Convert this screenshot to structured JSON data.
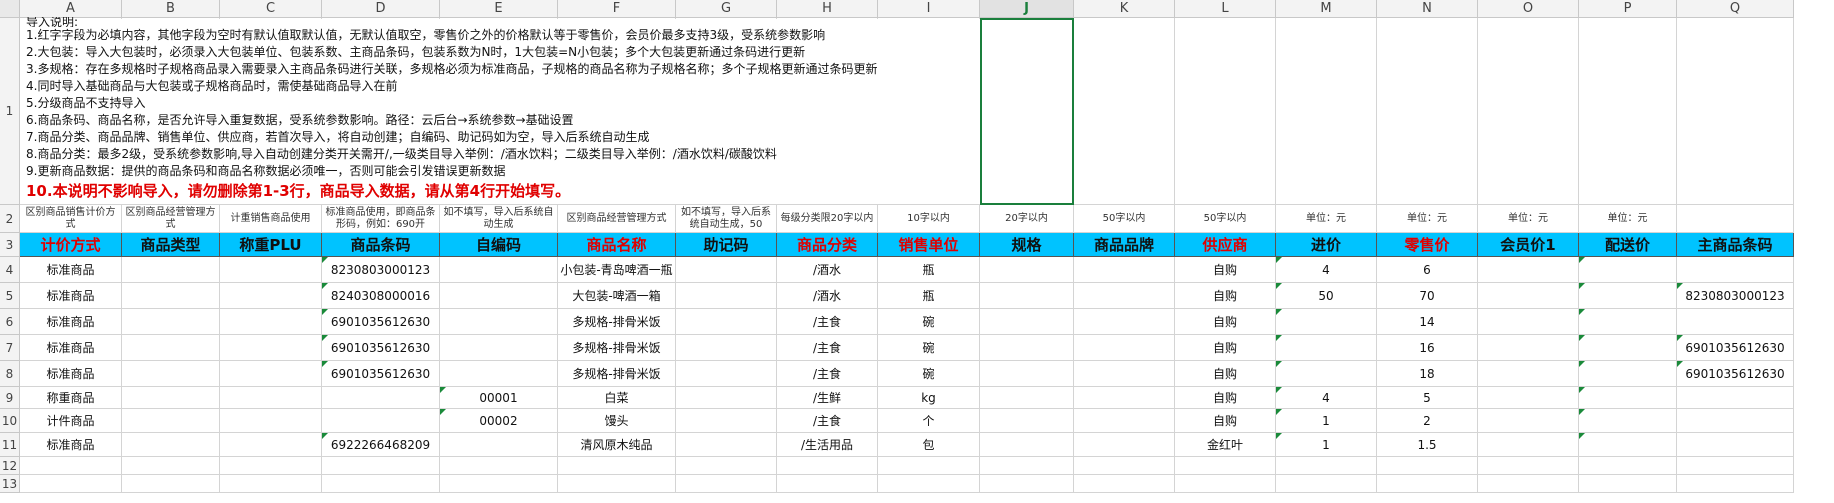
{
  "columns": [
    "A",
    "B",
    "C",
    "D",
    "E",
    "F",
    "G",
    "H",
    "I",
    "J",
    "K",
    "L",
    "M",
    "N",
    "O",
    "P",
    "Q"
  ],
  "selected_column": "J",
  "rows": [
    "1",
    "2",
    "3",
    "4",
    "5",
    "6",
    "7",
    "8",
    "9",
    "10",
    "11",
    "12",
    "13"
  ],
  "instructions": {
    "title": "导入说明:",
    "lines": [
      "1.红字字段为必填内容，其他字段为空时有默认值取默认值，无默认值取空，零售价之外的价格默认等于零售价，会员价最多支持3级，受系统参数影响",
      "2.大包装：导入大包装时，必须录入大包装单位、包装系数、主商品条码，包装系数为N时，1大包装=N小包装；多个大包装更新通过条码进行更新",
      "3.多规格：存在多规格时子规格商品录入需要录入主商品条码进行关联，多规格必须为标准商品，子规格的商品名称为子规格名称；多个子规格更新通过条码更新",
      "4.同时导入基础商品与大包装或子规格商品时，需使基础商品导入在前",
      "5.分级商品不支持导入",
      "6.商品条码、商品名称，是否允许导入重复数据，受系统参数影响。路径：云后台→系统参数→基础设置",
      "7.商品分类、商品品牌、销售单位、供应商，若首次导入，将自动创建；自编码、助记码如为空，导入后系统自动生成",
      "8.商品分类：最多2级，受系统参数影响,导入自动创建分类开关需开/,一级类目导入举例：/酒水饮料；二级类目导入举例：/酒水饮料/碳酸饮料",
      "9.更新商品数据：提供的商品条码和商品名称数据必须唯一，否则可能会引发错误更新数据"
    ],
    "warning": "10.本说明不影响导入，请勿删除第1-3行，商品导入数据，请从第4行开始填写。"
  },
  "hints": [
    "区别商品销售计价方式",
    "区别商品经营管理方式",
    "计重销售商品使用",
    "标准商品使用，即商品条形码，例如：690开",
    "如不填写，导入后系统自动生成",
    "区别商品经营管理方式",
    "如不填写，导入后系统自动生成，50",
    "每级分类限20字以内",
    "10字以内",
    "20字以内",
    "50字以内",
    "50字以内",
    "单位：元",
    "单位：元",
    "单位：元",
    "单位：元",
    ""
  ],
  "headers": [
    {
      "label": "计价方式",
      "required": true
    },
    {
      "label": "商品类型",
      "required": false
    },
    {
      "label": "称重PLU",
      "required": false
    },
    {
      "label": "商品条码",
      "required": false
    },
    {
      "label": "自编码",
      "required": false
    },
    {
      "label": "商品名称",
      "required": true
    },
    {
      "label": "助记码",
      "required": false
    },
    {
      "label": "商品分类",
      "required": true
    },
    {
      "label": "销售单位",
      "required": true
    },
    {
      "label": "规格",
      "required": false
    },
    {
      "label": "商品品牌",
      "required": false
    },
    {
      "label": "供应商",
      "required": true
    },
    {
      "label": "进价",
      "required": false
    },
    {
      "label": "零售价",
      "required": true
    },
    {
      "label": "会员价1",
      "required": false
    },
    {
      "label": "配送价",
      "required": false
    },
    {
      "label": "主商品条码",
      "required": false
    }
  ],
  "data_rows": [
    [
      "标准商品",
      "",
      "",
      "8230803000123",
      "",
      "小包装-青岛啤酒一瓶",
      "",
      "/酒水",
      "瓶",
      "",
      "",
      "自购",
      "4",
      "6",
      "",
      "",
      ""
    ],
    [
      "标准商品",
      "",
      "",
      "8240308000016",
      "",
      "大包装-啤酒一箱",
      "",
      "/酒水",
      "瓶",
      "",
      "",
      "自购",
      "50",
      "70",
      "",
      "",
      "8230803000123"
    ],
    [
      "标准商品",
      "",
      "",
      "6901035612630",
      "",
      "多规格-排骨米饭",
      "",
      "/主食",
      "碗",
      "",
      "",
      "自购",
      "",
      "14",
      "",
      "",
      ""
    ],
    [
      "标准商品",
      "",
      "",
      "6901035612630",
      "",
      "多规格-排骨米饭",
      "",
      "/主食",
      "碗",
      "",
      "",
      "自购",
      "",
      "16",
      "",
      "",
      "6901035612630"
    ],
    [
      "标准商品",
      "",
      "",
      "6901035612630",
      "",
      "多规格-排骨米饭",
      "",
      "/主食",
      "碗",
      "",
      "",
      "自购",
      "",
      "18",
      "",
      "",
      "6901035612630"
    ],
    [
      "称重商品",
      "",
      "",
      "",
      "00001",
      "白菜",
      "",
      "/生鲜",
      "kg",
      "",
      "",
      "自购",
      "4",
      "5",
      "",
      "",
      ""
    ],
    [
      "计件商品",
      "",
      "",
      "",
      "00002",
      "馒头",
      "",
      "/主食",
      "个",
      "",
      "",
      "自购",
      "1",
      "2",
      "",
      "",
      ""
    ],
    [
      "标准商品",
      "",
      "",
      "6922266468209",
      "",
      "清风原木纯品",
      "",
      "/生活用品",
      "包",
      "",
      "",
      "金红叶",
      "1",
      "1.5",
      "",
      "",
      ""
    ],
    [
      "",
      "",
      "",
      "",
      "",
      "",
      "",
      "",
      "",
      "",
      "",
      "",
      "",
      "",
      "",
      "",
      ""
    ],
    [
      "",
      "",
      "",
      "",
      "",
      "",
      "",
      "",
      "",
      "",
      "",
      "",
      "",
      "",
      "",
      "",
      ""
    ]
  ]
}
